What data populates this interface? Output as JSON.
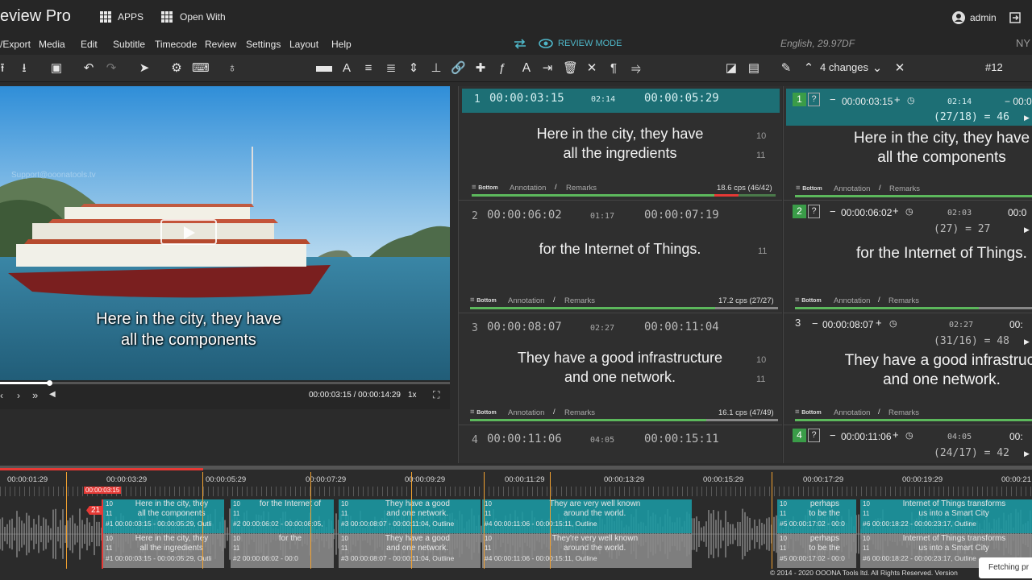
{
  "app": {
    "title": "eview Pro",
    "apps_label": "APPS",
    "open_with_label": "Open With",
    "user": "admin"
  },
  "menu": [
    "/Export",
    "Media",
    "Edit",
    "Subtitle",
    "Timecode",
    "Review",
    "Settings",
    "Layout",
    "Help"
  ],
  "mode": {
    "label": "REVIEW MODE",
    "language": "English, 29.97DF",
    "edge_text": "NY"
  },
  "toolbar": {
    "changes": "4 changes",
    "counter": "#12"
  },
  "video": {
    "subtitle_line1": "Here in the city, they have",
    "subtitle_line2": "all the components",
    "time": "00:00:03:15 / 00:00:14:29",
    "speed": "1x",
    "watermark": "Support@ooonatools.tv"
  },
  "grid1": [
    {
      "num": "1",
      "tc_in": "00:00:03:15",
      "dur": "02:14",
      "tc_out": "00:00:05:29",
      "text": "Here in the city, they have\nall the ingredients",
      "lines": [
        "10",
        "11"
      ],
      "cps": "18.6 cps (46/42)"
    },
    {
      "num": "2",
      "tc_in": "00:00:06:02",
      "dur": "01:17",
      "tc_out": "00:00:07:19",
      "text": "for the Internet of Things.",
      "lines": [
        "11"
      ],
      "cps": "17.2 cps (27/27)"
    },
    {
      "num": "3",
      "tc_in": "00:00:08:07",
      "dur": "02:27",
      "tc_out": "00:00:11:04",
      "text": "They have a good infrastructure\nand one network.",
      "lines": [
        "10",
        "11"
      ],
      "cps": "16.1 cps (47/49)"
    },
    {
      "num": "4",
      "tc_in": "00:00:11:06",
      "dur": "04:05",
      "tc_out": "00:00:15:11"
    }
  ],
  "grid2": [
    {
      "num": "1",
      "tc_in": "00:00:03:15",
      "dur": "02:14",
      "tc_out": "00:00",
      "ratio": "(27/18) = 46",
      "text": "Here in the city, they have\nall the components"
    },
    {
      "num": "2",
      "tc_in": "00:00:06:02",
      "dur": "02:03",
      "tc_out": "00:0",
      "ratio": "(27) = 27",
      "text": "for the Internet of Things."
    },
    {
      "num": "3",
      "tc_in": "00:00:08:07",
      "dur": "02:27",
      "tc_out": "00:",
      "ratio": "(31/16) = 48",
      "text": "They have a good infrastruct\nand one network."
    },
    {
      "num": "4",
      "tc_in": "00:00:11:06",
      "dur": "04:05",
      "tc_out": "00:",
      "ratio": "(24/17) = 42"
    }
  ],
  "cell_footer": {
    "pos": "Bottom",
    "annotation": "Annotation",
    "remarks": "Remarks"
  },
  "timeline": {
    "ticks": [
      "00:00:01:29",
      "00:00:03:29",
      "00:00:05:29",
      "00:00:07:29",
      "00:00:09:29",
      "00:00:11:29",
      "00:00:13:29",
      "00:00:15:29",
      "00:00:17:29",
      "00:00:19:29",
      "00:00:21"
    ],
    "playhead": "00:00:03:15",
    "badge": "21",
    "top_segments": [
      {
        "l1": "Here in the city, they",
        "l2": "all the components",
        "info": "#1 00:00:03:15 - 00:00:05:29, Outli"
      },
      {
        "l1": "for the Internet of",
        "l2": "",
        "info": "#2 00:00:06:02 - 00:00:08:05,"
      },
      {
        "l1": "They have a good",
        "l2": "and one network.",
        "info": "#3 00:00:08:07 - 00:00:11:04, Outline"
      },
      {
        "l1": "They are very well known",
        "l2": "around the world.",
        "info": "#4 00:00:11:06 - 00:00:15:11, Outline"
      },
      {
        "l1": "perhaps",
        "l2": "to be the",
        "info": "#5 00:00:17:02 - 00:0"
      },
      {
        "l1": "Internet of Things transforms",
        "l2": "us into a Smart City",
        "info": "#6 00:00:18:22 - 00:00:23:17, Outline"
      }
    ],
    "bottom_segments": [
      {
        "l1": "Here in the city, they",
        "l2": "all the ingredients",
        "info": "#1 00:00:03:15 - 00:00:05:29, Outli"
      },
      {
        "l1": "for the",
        "l2": "",
        "info": "#2 00:00:06:02 - 00:0"
      },
      {
        "l1": "They have a good",
        "l2": "and one network.",
        "info": "#3 00:00:08:07 - 00:00:11:04, Outline"
      },
      {
        "l1": "They're very well known",
        "l2": "around the world.",
        "info": "#4 00:00:11:06 - 00:00:15:11, Outline"
      },
      {
        "l1": "perhaps",
        "l2": "to be the",
        "info": "#5 00:00:17:02 - 00:0"
      },
      {
        "l1": "Internet of Things transforms",
        "l2": "us into a Smart City",
        "info": "#6 00:00:18:22 - 00:00:23:17, Outline"
      }
    ],
    "copyright": "© 2014 - 2020 OOONA Tools ltd. All Rights Reserved. Version",
    "fetching": "Fetching pr"
  },
  "colors": {
    "teal": "#1aa0a8",
    "accent": "#4fb7c9",
    "red": "#e53935",
    "green": "#5cb85c",
    "orange": "#f0a030"
  }
}
